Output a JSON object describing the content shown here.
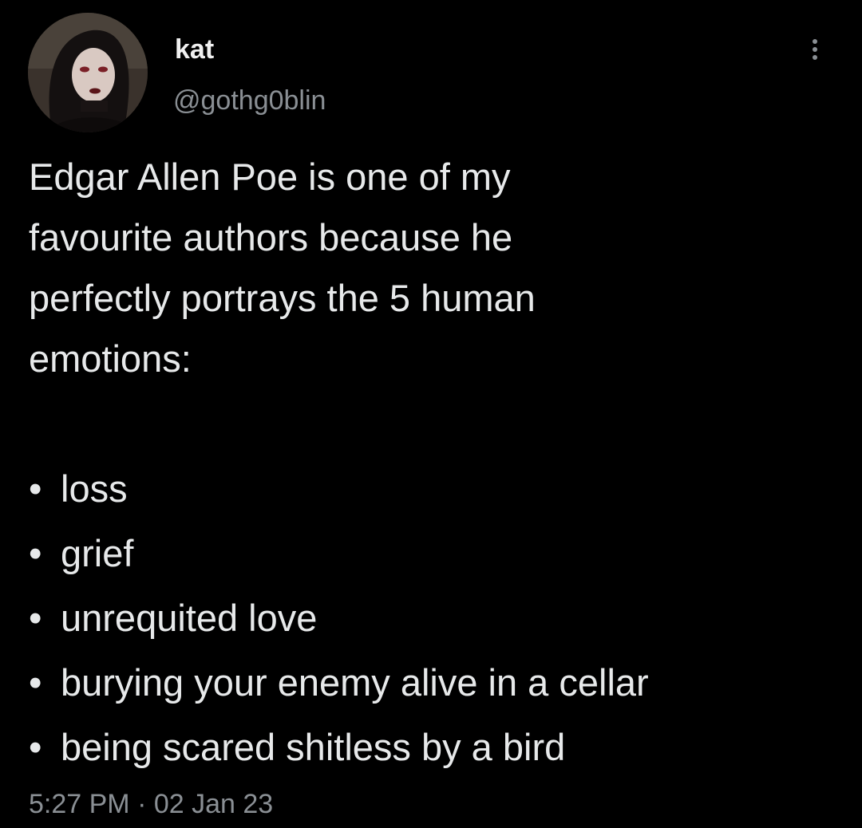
{
  "user": {
    "display_name": "kat",
    "handle": "@gothg0blin"
  },
  "tweet": {
    "text_lines": [
      "Edgar Allen Poe is one of my",
      "favourite authors because he",
      "perfectly portrays the 5 human",
      "emotions:"
    ],
    "bullet_glyph": "•",
    "items": [
      "loss",
      "grief",
      "unrequited love",
      "burying your enemy alive in a cellar",
      "being scared shitless by a bird"
    ],
    "time": "5:27 PM",
    "separator": "·",
    "date": "02 Jan 23"
  },
  "icons": {
    "more": "more-vertical-icon",
    "avatar": "profile-photo"
  },
  "colors": {
    "background": "#000000",
    "text": "#e7e9ea",
    "muted": "#8a8f94"
  }
}
